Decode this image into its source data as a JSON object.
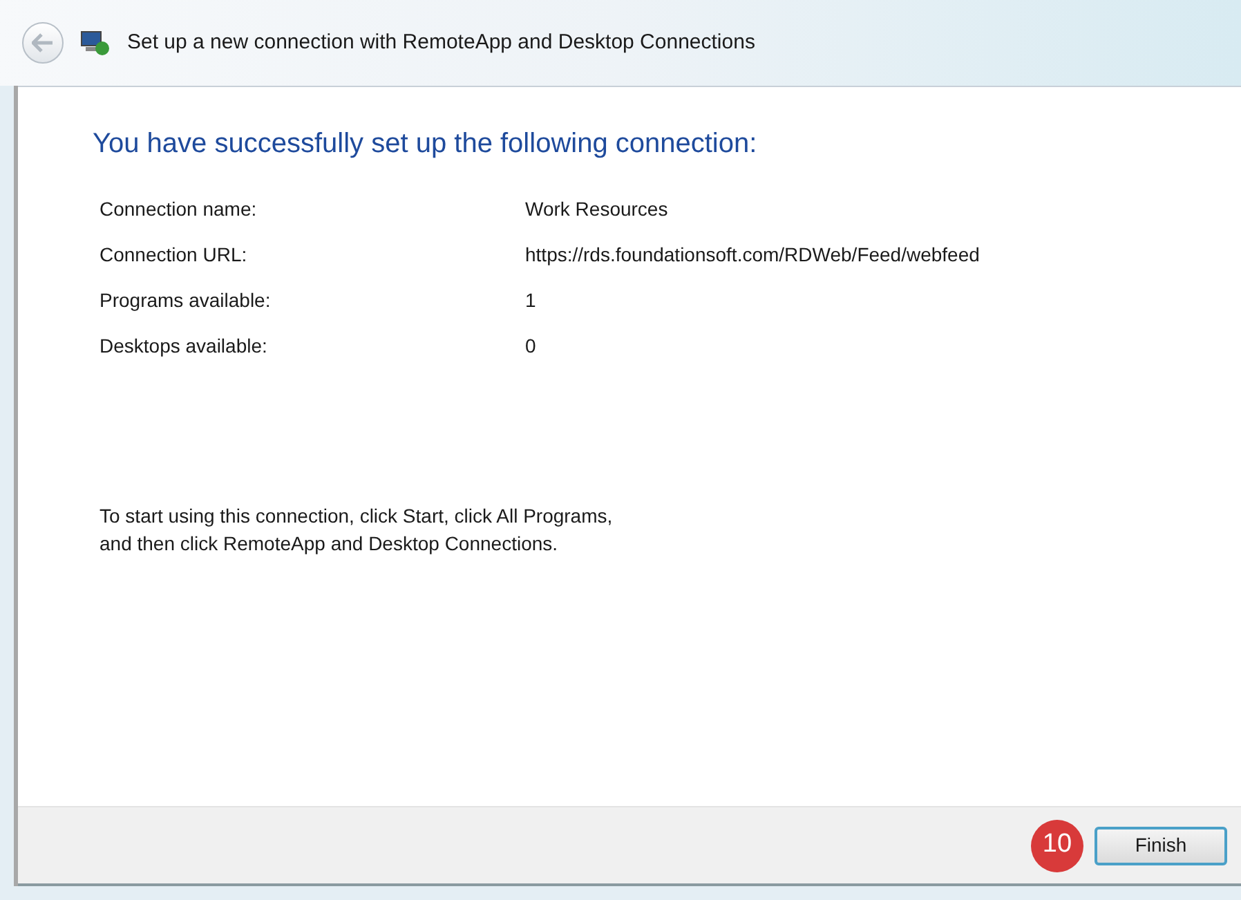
{
  "window": {
    "title": "Set up a new connection with RemoteApp and Desktop Connections"
  },
  "heading": "You have successfully set up the following connection:",
  "details": [
    {
      "label": "Connection name:",
      "value": "Work Resources"
    },
    {
      "label": "Connection URL:",
      "value": "https://rds.foundationsoft.com/RDWeb/Feed/webfeed"
    },
    {
      "label": "Programs available:",
      "value": "1"
    },
    {
      "label": "Desktops available:",
      "value": "0"
    }
  ],
  "instructions": "To start using this connection, click Start, click All Programs, and then click RemoteApp and Desktop Connections.",
  "step_badge": "10",
  "buttons": [
    {
      "label": "Finish"
    }
  ]
}
